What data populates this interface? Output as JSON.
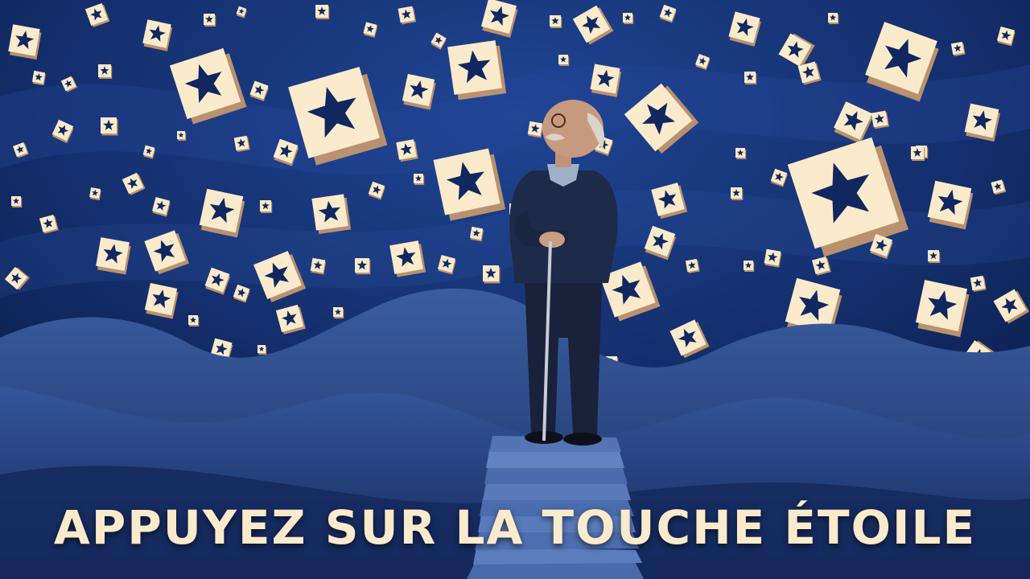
{
  "headline": "APPUYEZ SUR LA TOUCHE ÉTOILE",
  "scene": {
    "subject": "elderly-man-with-cane",
    "icon": "star-key-icon",
    "colors": {
      "sky": "#0c1f4f",
      "sky_light": "#1d3f8a",
      "hill": "#233f7f",
      "hill_light": "#3d63a8",
      "key_face": "#fbeacb",
      "key_side": "#b9916f",
      "star": "#10285f"
    }
  }
}
